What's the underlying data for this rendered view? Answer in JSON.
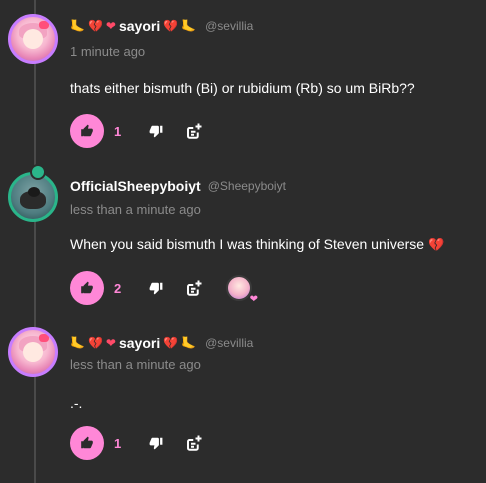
{
  "comments": [
    {
      "user": {
        "name": "sayori",
        "handle": "@sevillia",
        "decor_left": [
          "🦶",
          "💔",
          "❤"
        ],
        "decor_right": [
          "💔",
          "🦶"
        ]
      },
      "time": "1 minute ago",
      "text": "thats either bismuth (Bi) or rubidium (Rb) so um BiRb??",
      "likes": "1",
      "liked": true
    },
    {
      "user": {
        "name": "OfficialSheepyboiyt",
        "handle": "@Sheepyboiyt"
      },
      "time": "less than a minute ago",
      "text": "When you said bismuth I was thinking of Steven universe",
      "text_emoji": "💔",
      "likes": "2",
      "liked": true,
      "reacted_by_avatar": true
    },
    {
      "user": {
        "name": "sayori",
        "handle": "@sevillia",
        "decor_left": [
          "🦶",
          "💔",
          "❤"
        ],
        "decor_right": [
          "💔",
          "🦶"
        ]
      },
      "time": "less than a minute ago",
      "text": ".-.",
      "likes": "1",
      "liked": true
    }
  ],
  "colors": {
    "accent_pink": "#ff87d7",
    "background": "#2c2c2c",
    "muted_text": "#8b8b8b"
  },
  "icons": {
    "like": "thumbs-up-icon",
    "dislike": "thumbs-down-icon",
    "reply": "add-reply-icon"
  }
}
